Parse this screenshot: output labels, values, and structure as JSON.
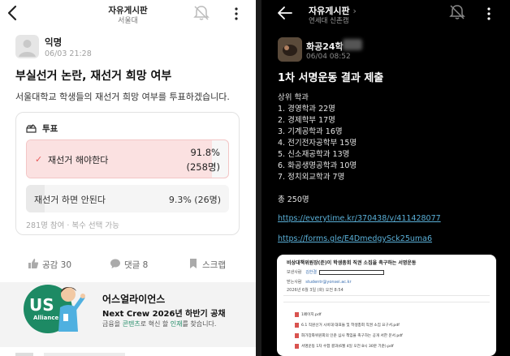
{
  "left_screen": {
    "header": {
      "title": "자유게시판",
      "subtitle": "서울대"
    },
    "post": {
      "author": "익명",
      "date": "06/03 21:28",
      "title": "부실선거 논란, 재선거 희망 여부",
      "body": "서울대학교 학생들의 재선거 희망 여부를 투표하겠습니다."
    },
    "poll": {
      "label": "투표",
      "options": [
        {
          "text": "재선거 해야한다",
          "percent": "91.8%",
          "count": "(258명)",
          "share": 0.918,
          "selected": true
        },
        {
          "text": "재선거 하면 안된다",
          "result": "9.3% (26명)",
          "share": 0.093,
          "selected": false
        }
      ],
      "footer": "281명 참여 · 복수 선택 가능"
    },
    "actions": {
      "like": "공감 30",
      "comment": "댓글 8",
      "scrap": "스크랩"
    },
    "banner": {
      "logo_us": "US",
      "logo_alliance": "Alliance",
      "title": "어스얼라이언스",
      "subtitle": "Next Crew 2026년 하반기 공채",
      "desc_prefix": "금융을 ",
      "desc_hl1": "콘텐츠",
      "desc_mid": "로 혁신 할 ",
      "desc_hl2": "인재",
      "desc_suffix": "를 찾습니다.",
      "accent": "#1d8a64"
    }
  },
  "right_screen": {
    "header": {
      "title": "자유게시판",
      "subtitle": "연세대 신촌캠"
    },
    "post": {
      "author": "화공24학",
      "date": "06/04 08:52",
      "title": "1차 서명운동 결과 제출",
      "list_heading": "상위 학과",
      "list": [
        "1. 경영학과 22명",
        "2. 경제학부 17명",
        "3. 기계공학과 16명",
        "4. 전기전자공학부 15명",
        "5. 신소재공학과 13명",
        "6. 화공생명공학과 10명",
        "7. 정치외교학과 7명"
      ],
      "total": "총 250명",
      "links": [
        "https://everytime.kr/370438/v/411428077",
        "https://forms.gle/E4DmedgySck25uma6"
      ]
    },
    "doc": {
      "title": "비상대책위원장(준)이 학생총회 직권 소집을 촉구하는 서명운동",
      "rows": [
        {
          "label": "보낸사람",
          "value": "김한결"
        },
        {
          "label": "받는사람",
          "value": "studentr@yonsei.ac.kr"
        }
      ],
      "date_line": "2026년 6월 3일 (화) 오전 8:54",
      "files": [
        "1페이지.pdf",
        "6.1 직원선거 시비대 대표들 및 학생총회 직권 소집 요구서.pdf",
        "화가장화위원회의 인준 심사 책임을 촉구하는 공개 서한 문서.pdf",
        "서명운동 1차 수합 결과(6월 4일 오전 8시 30분 기준).pdf"
      ]
    }
  }
}
